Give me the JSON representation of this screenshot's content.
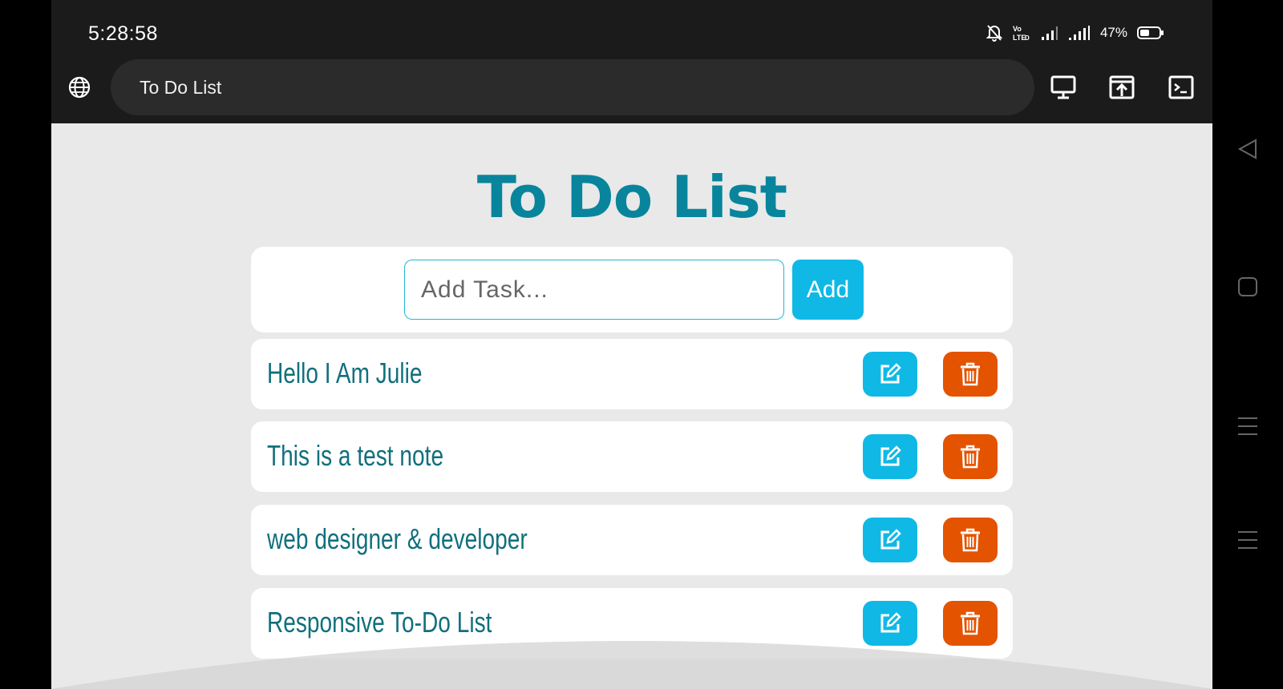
{
  "status_bar": {
    "time": "5:28:58",
    "battery": "47%",
    "icons": [
      "mute-bell-icon",
      "volte-icon",
      "signal-icon",
      "signal-icon",
      "battery-icon"
    ]
  },
  "browser": {
    "tab_title": "To Do List",
    "icons": [
      "globe-icon",
      "desktop-icon",
      "share-icon",
      "terminal-icon"
    ]
  },
  "app": {
    "title": "To Do List",
    "input": {
      "placeholder": "Add Task...",
      "value": ""
    },
    "add_label": "Add",
    "tasks": [
      {
        "text": "Hello I Am Julie"
      },
      {
        "text": "This is a test note"
      },
      {
        "text": "web designer & developer"
      },
      {
        "text": "Responsive To-Do List"
      }
    ]
  },
  "colors": {
    "title": "#08859c",
    "edit_button": "#10b8e6",
    "delete_button": "#e45300",
    "task_text": "#11707c",
    "page_bg": "#e9e9e9"
  },
  "nav_icons": [
    "back-icon",
    "home-icon",
    "menu-icon",
    "menu-icon"
  ]
}
